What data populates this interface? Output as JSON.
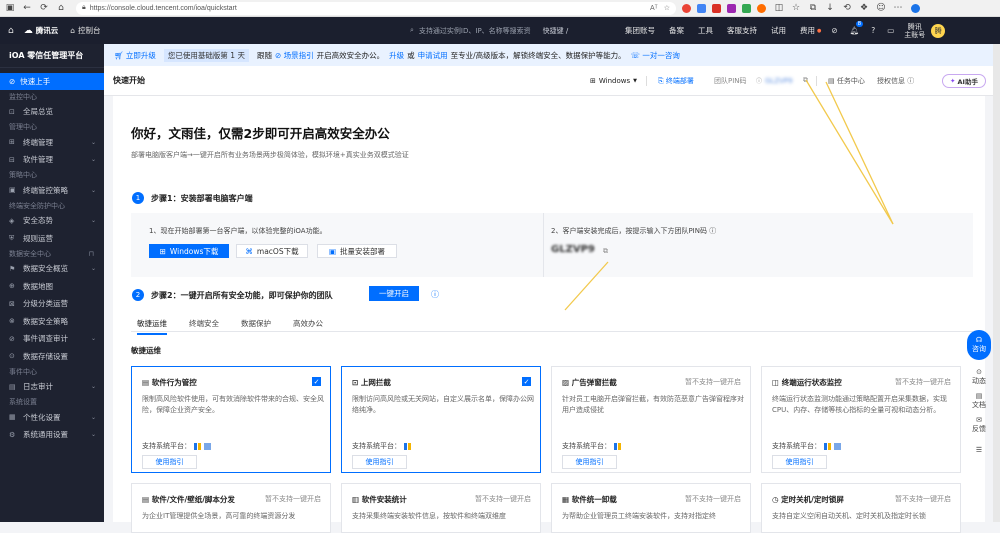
{
  "browser": {
    "url": "https://console.cloud.tencent.com/ioa/quickstart",
    "read_aloud": "Aᵀ"
  },
  "topbar": {
    "logo": "腾讯云",
    "console": "控制台",
    "search_placeholder": "支持通过实例ID、IP、名称等搜索资",
    "shortcut": "快捷键 /",
    "links": [
      "集团账号",
      "备案",
      "工具",
      "客服支持",
      "试用",
      "费用"
    ],
    "badge_count": "8",
    "user_line1": "腾讯",
    "user_line2": "主账号",
    "avatar_char": "腾"
  },
  "sidebar": {
    "title": "iOA 零信任管理平台",
    "active": "快速上手",
    "sections": [
      {
        "group": "监控中心",
        "items": [
          {
            "label": "全局总览",
            "chev": false
          }
        ]
      },
      {
        "group": "管理中心",
        "items": [
          {
            "label": "终端管理",
            "chev": true
          },
          {
            "label": "软件管理",
            "chev": true
          }
        ]
      },
      {
        "group": "策略中心",
        "items": [
          {
            "label": "终端管控策略",
            "chev": true
          }
        ]
      },
      {
        "group": "终端安全防护中心",
        "items": [
          {
            "label": "安全态势",
            "chev": true
          },
          {
            "label": "规则运营",
            "chev": false
          }
        ]
      },
      {
        "group": "数据安全中心",
        "lock": true,
        "items": [
          {
            "label": "数据安全概览",
            "chev": true
          },
          {
            "label": "数据地图",
            "chev": false
          },
          {
            "label": "分级分类运营",
            "chev": false
          },
          {
            "label": "数据安全策略",
            "chev": false
          },
          {
            "label": "事件调查审计",
            "chev": true
          },
          {
            "label": "数据存储设置",
            "chev": false
          }
        ]
      },
      {
        "group": "事件中心",
        "items": [
          {
            "label": "日志审计",
            "chev": true
          }
        ]
      },
      {
        "group": "系统设置",
        "items": [
          {
            "label": "个性化设置",
            "chev": true
          },
          {
            "label": "系统通用设置",
            "chev": true
          }
        ]
      }
    ]
  },
  "banner": {
    "upgrade_now": "立即升级",
    "text1": "您已使用基础版第 1 天",
    "follow": "跟随",
    "scene_guide": "场景指引",
    "text2": "开启高效安全办公。",
    "upgrade": "升级",
    "or": "或",
    "apply_trial": "申请试用",
    "text3": "至专业/高级版本，解锁终端安全、数据保护等能力。",
    "consult": "一对一咨询"
  },
  "pagehead": {
    "title": "快速开始",
    "os": "Windows",
    "deploy": "终端部署",
    "pin_label": "团队PIN码",
    "pin_value": "GLZVP9",
    "tasks": "任务中心",
    "license": "授权信息",
    "ai": "AI助手"
  },
  "main": {
    "greeting": "你好，文雨佳，仅需2步即可开启高效安全办公",
    "subtitle": "部署电脑版客户端→一键开启所有业务场景两步极简体验，模拟环境+真实业务双模式验证",
    "step1_num": "1",
    "step1_title": "步骤1：安装部署电脑客户端",
    "step1_desc1": "1、现在开始部署第一台客户端，以体验完整的iOA功能。",
    "btn_windows": "Windows下载",
    "btn_mac": "macOS下载",
    "btn_batch": "批量安装部署",
    "step1_desc2": "2、客户端安装完成后，按提示输入下方团队PIN码",
    "pin": "GLZVP9",
    "step2_num": "2",
    "step2_title": "步骤2：一键开启所有安全功能，即可保护你的团队",
    "btn_enable": "一键开启",
    "tabs": [
      "敏捷运维",
      "终端安全",
      "数据保护",
      "高效办公"
    ],
    "section": "敏捷运维",
    "platform_label": "支持系统平台：",
    "guide": "使用指引",
    "not_supported": "暂不支持一键开启",
    "cards": [
      {
        "icon": "▤",
        "title": "软件行为管控",
        "desc": "限制高风险软件使用，可有效消除软件带来的合规、安全风险，保障企业资产安全。",
        "selected": true
      },
      {
        "icon": "⊡",
        "title": "上网拦截",
        "desc": "限制访问高风险或无关网站，自定义展示名单，保障办公网络纯净。",
        "selected": true
      },
      {
        "icon": "▨",
        "title": "广告弹窗拦截",
        "desc": "针对员工电脑开启弹窗拦截，有效防范恶意广告弹窗程序对用户造成侵扰",
        "selected": false
      },
      {
        "icon": "◫",
        "title": "终端运行状态监控",
        "desc": "终端运行状态监测功能通过策略配置开启采集数据，实现CPU、内存、存储等核心指标的全量可视和动态分析。",
        "selected": false
      }
    ],
    "cards_row2": [
      {
        "icon": "▤",
        "title": "软件/文件/壁纸/脚本分发",
        "desc": "为企业IT管理提供全场景，高可靠的终端资源分发"
      },
      {
        "icon": "▥",
        "title": "软件安装统计",
        "desc": "支持采集终端安装软件信息，按软件和终端双维度"
      },
      {
        "icon": "▦",
        "title": "软件统一卸载",
        "desc": "为帮助企业管理员工终端安装软件，支持对指定终"
      },
      {
        "icon": "◷",
        "title": "定时关机/定时锁屏",
        "desc": "支持自定义空闲自动关机、定时关机及指定时长锁"
      }
    ]
  },
  "floatbar": {
    "consult": "咨询",
    "items": [
      "动态",
      "文档",
      "反馈"
    ]
  }
}
